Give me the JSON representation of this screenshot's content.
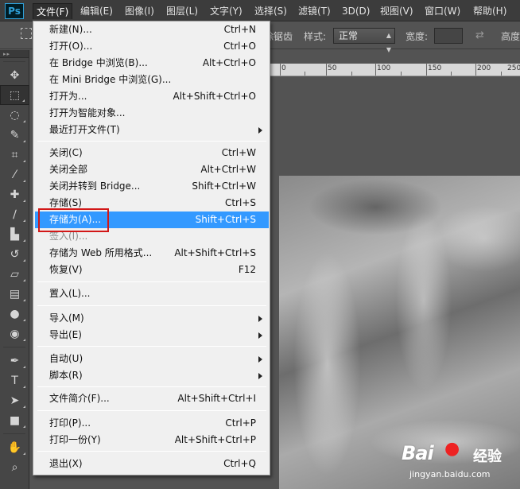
{
  "app": {
    "logo": "Ps"
  },
  "menubar": {
    "items": [
      {
        "label": "文件(F)"
      },
      {
        "label": "编辑(E)"
      },
      {
        "label": "图像(I)"
      },
      {
        "label": "图层(L)"
      },
      {
        "label": "文字(Y)"
      },
      {
        "label": "选择(S)"
      },
      {
        "label": "滤镜(T)"
      },
      {
        "label": "3D(D)"
      },
      {
        "label": "视图(V)"
      },
      {
        "label": "窗口(W)"
      },
      {
        "label": "帮助(H)"
      }
    ]
  },
  "options_bar": {
    "partial_text": "除锯齿",
    "style_label": "样式:",
    "style_value": "正常",
    "width_label": "宽度:",
    "height_label": "高度"
  },
  "ruler": {
    "labels": [
      "0",
      "50",
      "100",
      "150",
      "200",
      "250"
    ]
  },
  "file_menu": {
    "items": [
      {
        "label": "新建(N)...",
        "shortcut": "Ctrl+N"
      },
      {
        "label": "打开(O)...",
        "shortcut": "Ctrl+O"
      },
      {
        "label": "在 Bridge 中浏览(B)...",
        "shortcut": "Alt+Ctrl+O"
      },
      {
        "label": "在 Mini Bridge 中浏览(G)...",
        "shortcut": ""
      },
      {
        "label": "打开为...",
        "shortcut": "Alt+Shift+Ctrl+O"
      },
      {
        "label": "打开为智能对象...",
        "shortcut": ""
      },
      {
        "label": "最近打开文件(T)",
        "shortcut": ""
      },
      {
        "label": "关闭(C)",
        "shortcut": "Ctrl+W"
      },
      {
        "label": "关闭全部",
        "shortcut": "Alt+Ctrl+W"
      },
      {
        "label": "关闭并转到 Bridge...",
        "shortcut": "Shift+Ctrl+W"
      },
      {
        "label": "存储(S)",
        "shortcut": "Ctrl+S"
      },
      {
        "label": "存储为(A)...",
        "shortcut": "Shift+Ctrl+S"
      },
      {
        "label": "签入(I)...",
        "shortcut": ""
      },
      {
        "label": "存储为 Web 所用格式...",
        "shortcut": "Alt+Shift+Ctrl+S"
      },
      {
        "label": "恢复(V)",
        "shortcut": "F12"
      },
      {
        "label": "置入(L)...",
        "shortcut": ""
      },
      {
        "label": "导入(M)",
        "shortcut": ""
      },
      {
        "label": "导出(E)",
        "shortcut": ""
      },
      {
        "label": "自动(U)",
        "shortcut": ""
      },
      {
        "label": "脚本(R)",
        "shortcut": ""
      },
      {
        "label": "文件简介(F)...",
        "shortcut": "Alt+Shift+Ctrl+I"
      },
      {
        "label": "打印(P)...",
        "shortcut": "Ctrl+P"
      },
      {
        "label": "打印一份(Y)",
        "shortcut": "Alt+Shift+Ctrl+P"
      },
      {
        "label": "退出(X)",
        "shortcut": "Ctrl+Q"
      }
    ]
  },
  "watermark": {
    "logo": "Bai",
    "logo_cn": "经验",
    "url": "jingyan.baidu.com"
  },
  "colors": {
    "highlight": "#3399ff",
    "annotation": "#d21717",
    "menu_bg": "#f0f0f0"
  }
}
